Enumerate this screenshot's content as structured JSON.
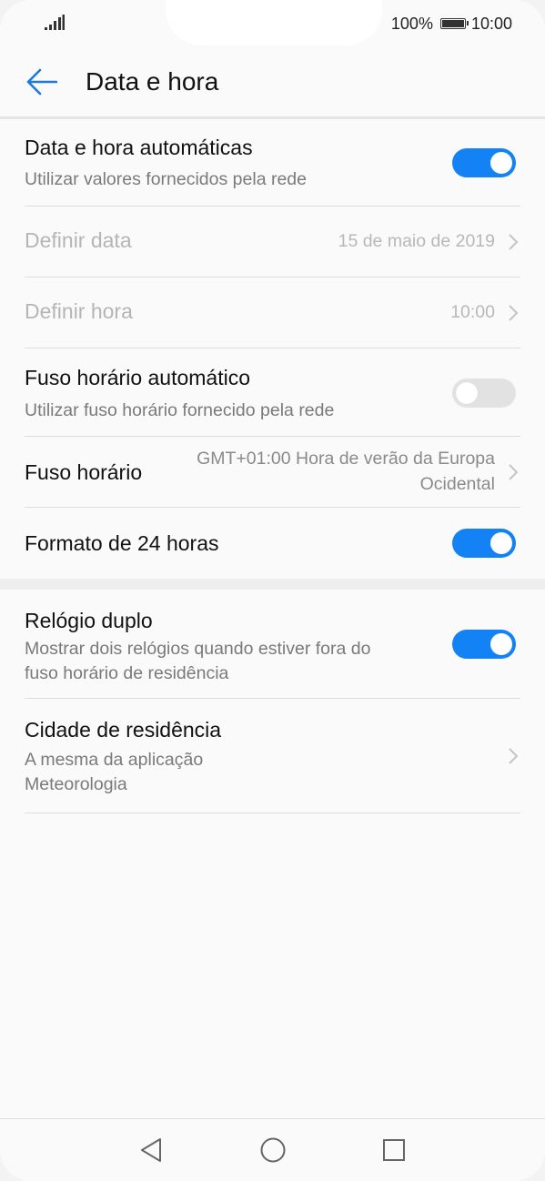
{
  "status_bar": {
    "battery_percent": "100%",
    "time": "10:00"
  },
  "header": {
    "title": "Data e hora"
  },
  "settings": {
    "auto_datetime": {
      "title": "Data e hora automáticas",
      "subtitle": "Utilizar valores fornecidos pela rede",
      "enabled": true
    },
    "set_date": {
      "title": "Definir data",
      "value": "15 de maio de 2019"
    },
    "set_time": {
      "title": "Definir hora",
      "value": "10:00"
    },
    "auto_timezone": {
      "title": "Fuso horário automático",
      "subtitle": "Utilizar fuso horário fornecido pela rede",
      "enabled": false
    },
    "timezone": {
      "title": "Fuso horário",
      "value_line1": "GMT+01:00 Hora de verão da Europa",
      "value_line2": "Ocidental"
    },
    "format_24h": {
      "title": "Formato de 24 horas",
      "enabled": true
    },
    "dual_clock": {
      "title": "Relógio duplo",
      "subtitle_line1": "Mostrar dois relógios quando estiver fora do",
      "subtitle_line2": "fuso horário de residência",
      "enabled": true
    },
    "home_city": {
      "title": "Cidade de residência",
      "subtitle_line1": "A mesma da aplicação",
      "subtitle_line2": "Meteorologia"
    }
  },
  "colors": {
    "accent": "#1282f5",
    "toggle_off": "#e2e2e2"
  },
  "icons": {
    "back": "arrow-left-icon",
    "chevron": "chevron-right-icon",
    "nav_back": "triangle-back-icon",
    "nav_home": "circle-home-icon",
    "nav_recents": "square-recents-icon"
  }
}
